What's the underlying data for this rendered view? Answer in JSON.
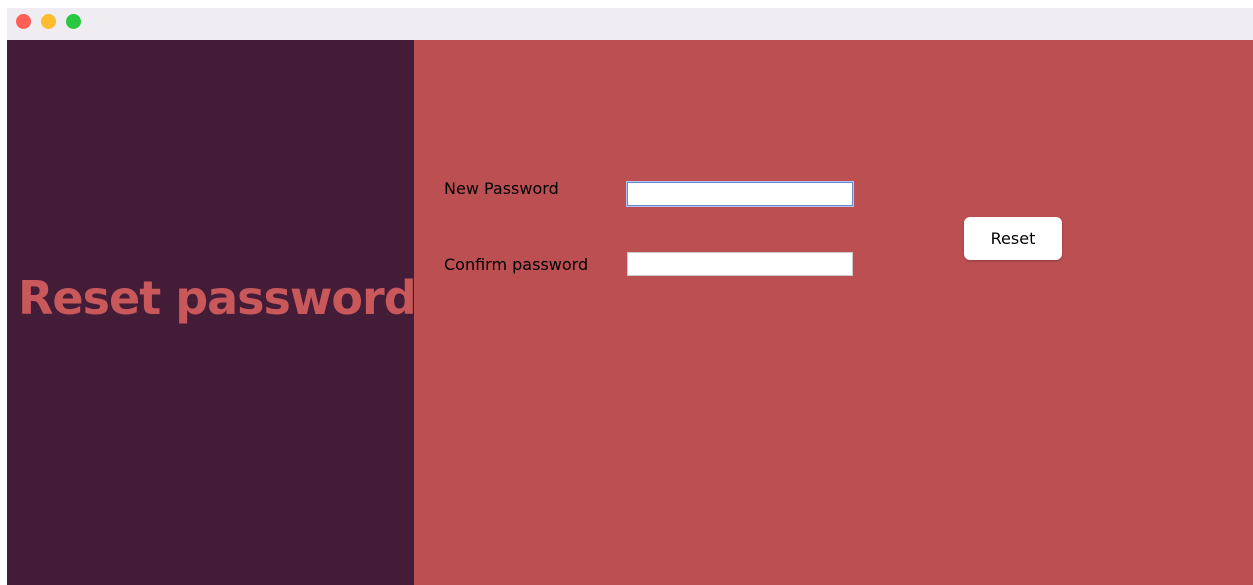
{
  "colors": {
    "titlebar_close": "#ff5f57",
    "titlebar_minimize": "#febc2e",
    "titlebar_maximize": "#28c840",
    "left_panel_bg": "#431c38",
    "right_panel_bg": "#bc4f51",
    "heading_text": "#c9585a"
  },
  "left_panel": {
    "heading": "Reset password"
  },
  "form": {
    "new_password_label": "New Password",
    "new_password_value": "",
    "confirm_password_label": "Confirm password",
    "confirm_password_value": "",
    "reset_label": "Reset"
  }
}
